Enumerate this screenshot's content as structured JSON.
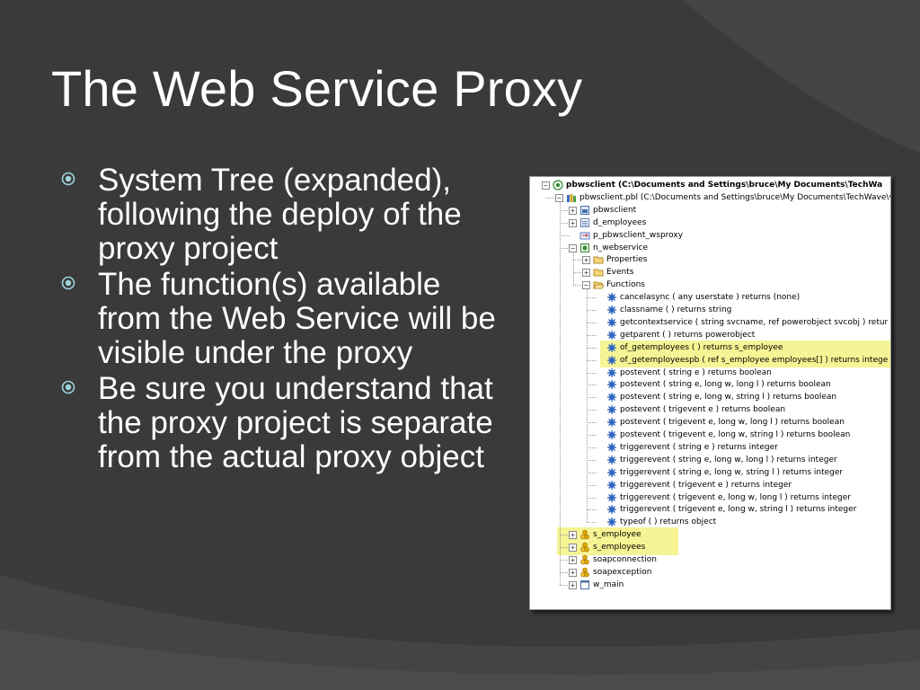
{
  "slide": {
    "title": "The Web Service Proxy",
    "bullets": [
      "System Tree (expanded), following the deploy of the proxy project",
      "The function(s) available from the Web Service will be visible under the proxy",
      "Be sure you understand that the proxy project is separate from the actual proxy object"
    ]
  },
  "colors": {
    "background": "#3a3a3a",
    "highlight": "#f6f494",
    "text": "#ffffff"
  },
  "tree": {
    "nodes": [
      {
        "label": "pbwsclient (C:\\Documents and Settings\\bruce\\My Documents\\TechWa",
        "icon": "target-icon",
        "expander": "−",
        "level": 0
      },
      {
        "label": "pbwsclient.pbl (C:\\Documents and Settings\\bruce\\My Documents\\TechWave\\w",
        "icon": "library-icon",
        "expander": "−",
        "level": 1
      },
      {
        "label": "pbwsclient",
        "icon": "application-icon",
        "expander": "+",
        "level": 2
      },
      {
        "label": "d_employees",
        "icon": "datawindow-icon",
        "expander": "+",
        "level": 2
      },
      {
        "label": "p_pbwsclient_wsproxy",
        "icon": "proxy-project-icon",
        "expander": "",
        "level": 2
      },
      {
        "label": "n_webservice",
        "icon": "userobject-icon",
        "expander": "−",
        "level": 2
      },
      {
        "label": "Properties",
        "icon": "folder-icon",
        "expander": "+",
        "level": 3
      },
      {
        "label": "Events",
        "icon": "folder-icon",
        "expander": "+",
        "level": 3
      },
      {
        "label": "Functions",
        "icon": "folder-open-icon",
        "expander": "−",
        "level": 3
      },
      {
        "label": "cancelasync ( any userstate ) returns (none)",
        "icon": "function-icon",
        "level": 4
      },
      {
        "label": "classname ( ) returns string",
        "icon": "function-icon",
        "level": 4
      },
      {
        "label": "getcontextservice ( string svcname, ref powerobject svcobj ) retur",
        "icon": "function-icon",
        "level": 4
      },
      {
        "label": "getparent ( ) returns powerobject",
        "icon": "function-icon",
        "level": 4
      },
      {
        "label": "of_getemployees ( ) returns s_employee",
        "icon": "function-icon",
        "level": 4
      },
      {
        "label": "of_getemployeespb ( ref s_employee employees[] ) returns intege",
        "icon": "function-icon",
        "level": 4
      },
      {
        "label": "postevent ( string e ) returns boolean",
        "icon": "function-icon",
        "level": 4
      },
      {
        "label": "postevent ( string e, long w, long l ) returns boolean",
        "icon": "function-icon",
        "level": 4
      },
      {
        "label": "postevent ( string e, long w, string l ) returns boolean",
        "icon": "function-icon",
        "level": 4
      },
      {
        "label": "postevent ( trigevent e ) returns boolean",
        "icon": "function-icon",
        "level": 4
      },
      {
        "label": "postevent ( trigevent e, long w, long l ) returns boolean",
        "icon": "function-icon",
        "level": 4
      },
      {
        "label": "postevent ( trigevent e, long w, string l ) returns boolean",
        "icon": "function-icon",
        "level": 4
      },
      {
        "label": "triggerevent ( string e ) returns integer",
        "icon": "function-icon",
        "level": 4
      },
      {
        "label": "triggerevent ( string e, long w, long l ) returns integer",
        "icon": "function-icon",
        "level": 4
      },
      {
        "label": "triggerevent ( string e, long w, string l ) returns integer",
        "icon": "function-icon",
        "level": 4
      },
      {
        "label": "triggerevent ( trigevent e ) returns integer",
        "icon": "function-icon",
        "level": 4
      },
      {
        "label": "triggerevent ( trigevent e, long w, long l ) returns integer",
        "icon": "function-icon",
        "level": 4
      },
      {
        "label": "triggerevent ( trigevent e, long w, string l ) returns integer",
        "icon": "function-icon",
        "level": 4
      },
      {
        "label": "typeof ( ) returns object",
        "icon": "function-icon",
        "level": 4
      },
      {
        "label": "s_employee",
        "icon": "structure-icon",
        "expander": "+",
        "level": 2
      },
      {
        "label": "s_employees",
        "icon": "structure-icon",
        "expander": "+",
        "level": 2
      },
      {
        "label": "soapconnection",
        "icon": "structure-icon",
        "expander": "+",
        "level": 2
      },
      {
        "label": "soapexception",
        "icon": "structure-icon",
        "expander": "+",
        "level": 2
      },
      {
        "label": "w_main",
        "icon": "window-icon",
        "expander": "+",
        "level": 2
      }
    ],
    "highlighted_rows": [
      13,
      14,
      28,
      29
    ]
  }
}
